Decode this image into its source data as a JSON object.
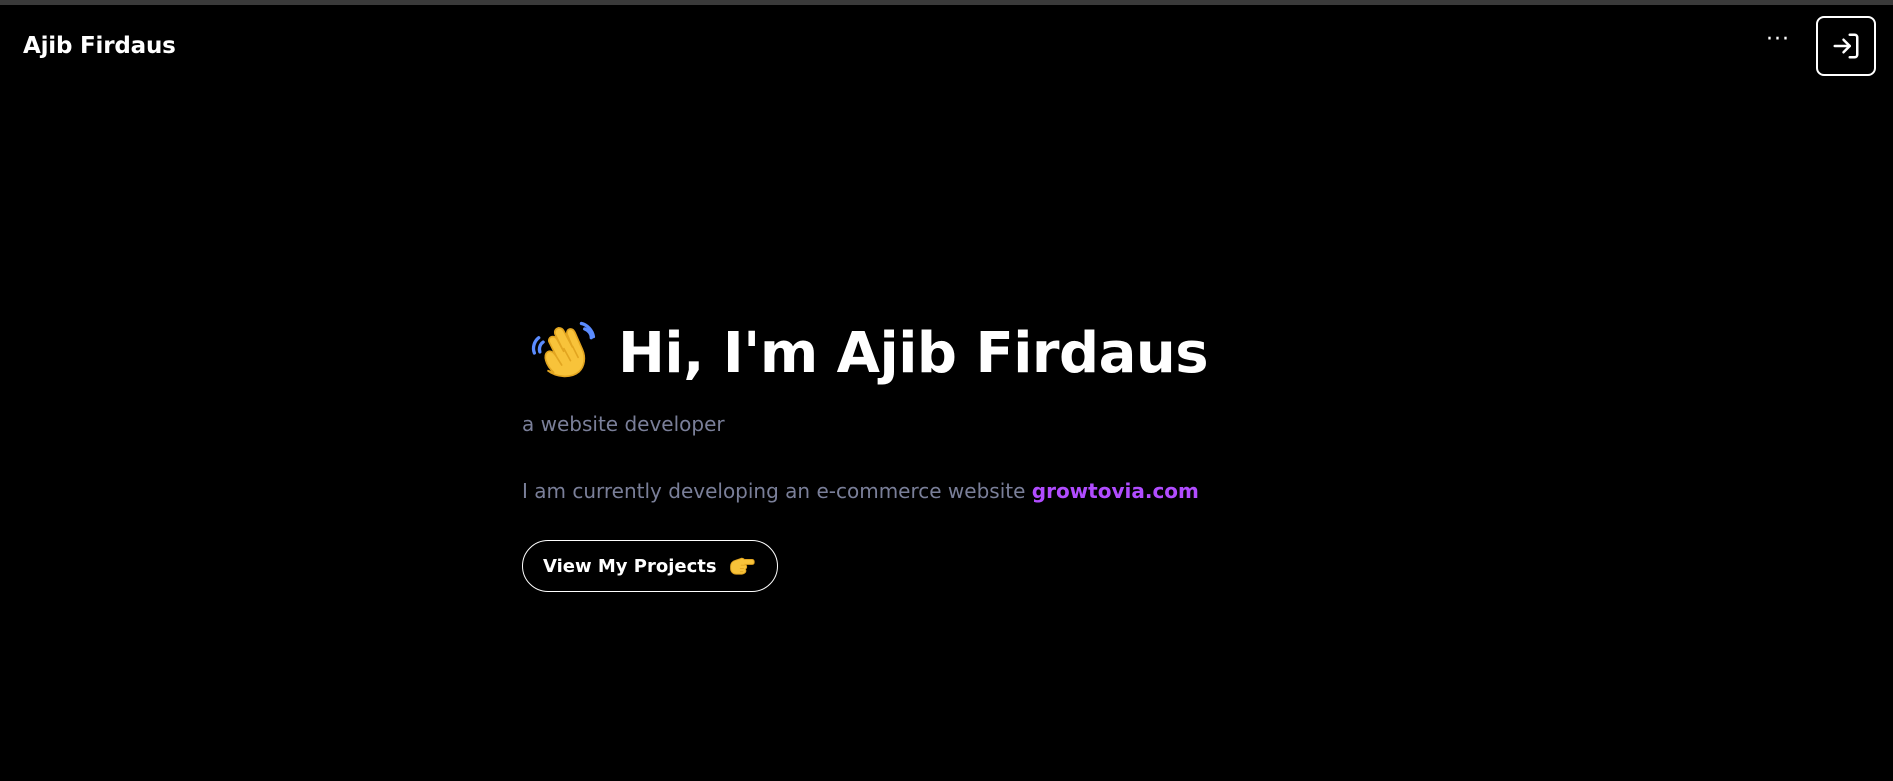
{
  "navbar": {
    "brand": "Ajib Firdaus",
    "more_icon": "ellipsis-icon",
    "more_label": "···",
    "login_icon": "sign-in-icon"
  },
  "hero": {
    "wave_icon": "waving-hand-icon",
    "heading": "Hi, I'm Ajib Firdaus",
    "subtitle": "a website developer",
    "description_prefix": "I am currently developing an e-commerce website ",
    "link_text": "growtovia.com",
    "button_label": "View My Projects",
    "button_icon": "pointing-hand-icon"
  },
  "colors": {
    "background": "#000000",
    "text": "#ffffff",
    "muted": "#7a7f99",
    "accent": "#b14cff"
  }
}
